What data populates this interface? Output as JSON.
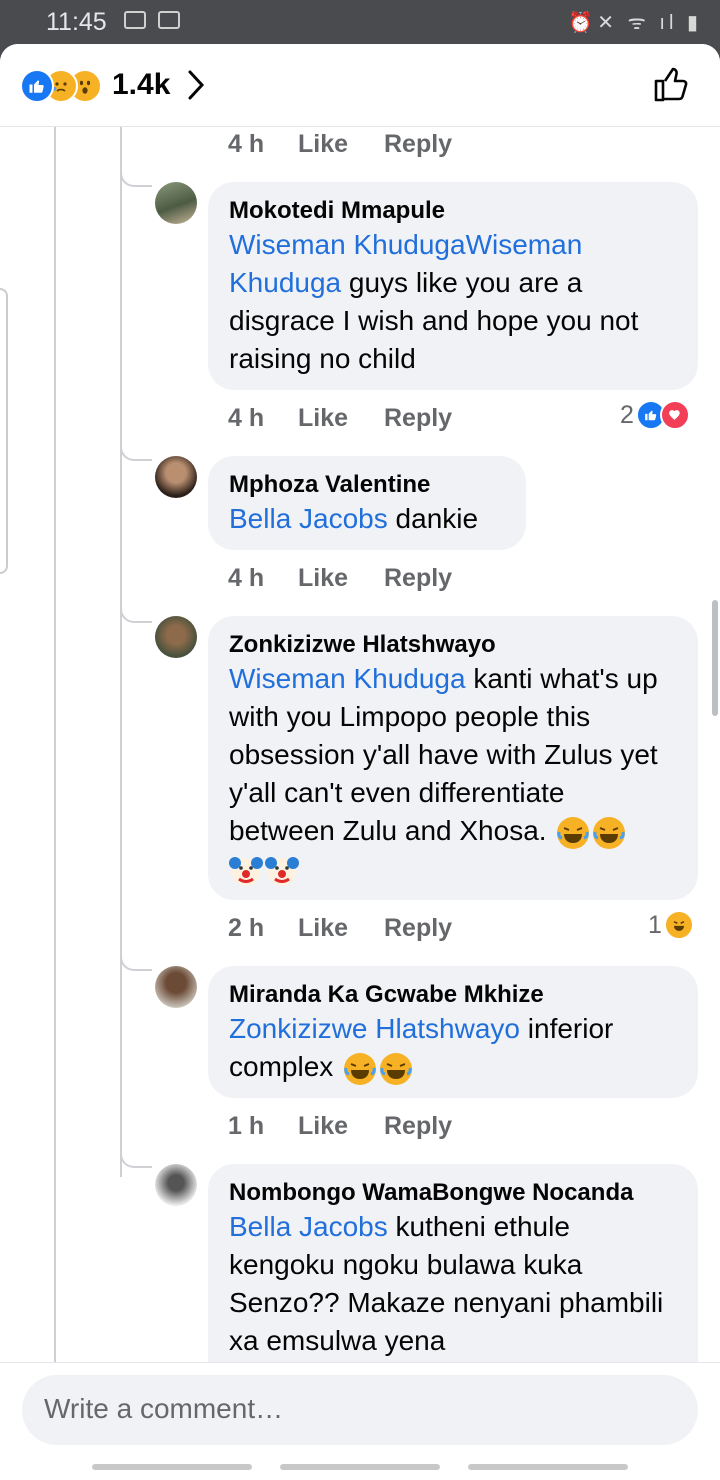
{
  "status_bar": {
    "time": "11:45"
  },
  "header": {
    "reaction_count": "1.4k"
  },
  "prev_meta": {
    "time": "4 h",
    "like": "Like",
    "reply": "Reply"
  },
  "comments": [
    {
      "author": "Mokotedi Mmapule",
      "mention": "Wiseman KhudugaWiseman Khuduga",
      "text": " guys like you are a disgrace I wish and hope you not raising no child",
      "time": "4 h",
      "like": "Like",
      "reply": "Reply",
      "reactions": "2"
    },
    {
      "author": "Mphoza Valentine",
      "mention": "Bella Jacobs",
      "text": " dankie",
      "time": "4 h",
      "like": "Like",
      "reply": "Reply"
    },
    {
      "author": "Zonkizizwe Hlatshwayo",
      "mention": "Wiseman Khuduga",
      "text": " kanti what's up with you Limpopo people this obsession y'all have with Zulus yet y'all can't even differentiate between Zulu and Xhosa. ",
      "time": "2 h",
      "like": "Like",
      "reply": "Reply",
      "reactions": "1"
    },
    {
      "author": "Miranda Ka Gcwabe Mkhize",
      "mention": "Zonkizizwe Hlatshwayo",
      "text": " inferior complex ",
      "time": "1 h",
      "like": "Like",
      "reply": "Reply"
    },
    {
      "author": "Nombongo WamaBongwe Nocanda",
      "mention": "Bella Jacobs",
      "text": " kutheni ethule kengoku ngoku bulawa kuka Senzo?? Makaze nenyani phambili xa emsulwa yena"
    }
  ],
  "composer": {
    "placeholder": "Write a comment…"
  },
  "colors": {
    "mention": "#216fdb",
    "like_blue": "#1877f2",
    "love_red": "#f33e58",
    "bubble": "#f0f2f5"
  }
}
